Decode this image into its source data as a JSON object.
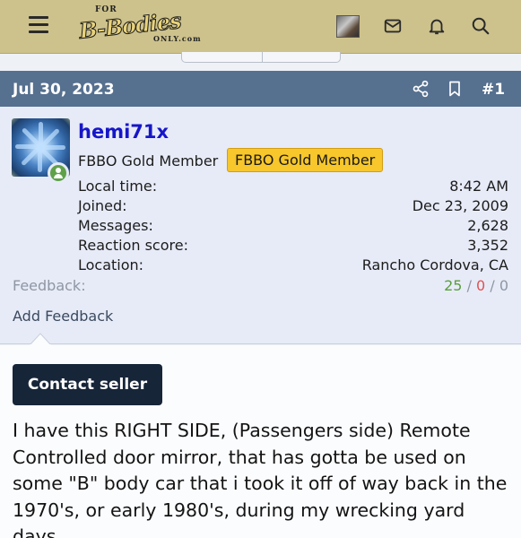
{
  "header": {
    "logo": {
      "top": "FOR",
      "main": "B-Bodies",
      "bottom": "ONLY.com"
    },
    "icons": [
      "menu-icon",
      "user-avatar",
      "envelope-icon",
      "bell-icon",
      "search-icon"
    ]
  },
  "post": {
    "date": "Jul 30, 2023",
    "number": "#1",
    "icons": [
      "share-icon",
      "bookmark-icon"
    ]
  },
  "user": {
    "username": "hemi71x",
    "title": "FBBO Gold Member",
    "badge": "FBBO Gold Member",
    "info": [
      {
        "label": "Local time:",
        "value": "8:42 AM"
      },
      {
        "label": "Joined:",
        "value": "Dec 23, 2009"
      },
      {
        "label": "Messages:",
        "value": "2,628"
      },
      {
        "label": "Reaction score:",
        "value": "3,352"
      },
      {
        "label": "Location:",
        "value": "Rancho Cordova, CA"
      }
    ],
    "feedback": {
      "label": "Feedback:",
      "positive": "25",
      "negative": "0",
      "neutral": "0",
      "separator": "/"
    },
    "add_feedback": "Add Feedback"
  },
  "content": {
    "contact_button": "Contact seller",
    "message": "I have this RIGHT SIDE, (Passengers side) Remote Controlled door mirror, that has gotta be used on some \"B\" body car that i took it off of way back in the 1970's, or early 1980's, during my wrecking yard days."
  },
  "colors": {
    "header_bg": "#cdc28c",
    "post_bar": "#56708f",
    "username": "#1616c8",
    "badge": "#f7c72b",
    "button": "#172539"
  }
}
